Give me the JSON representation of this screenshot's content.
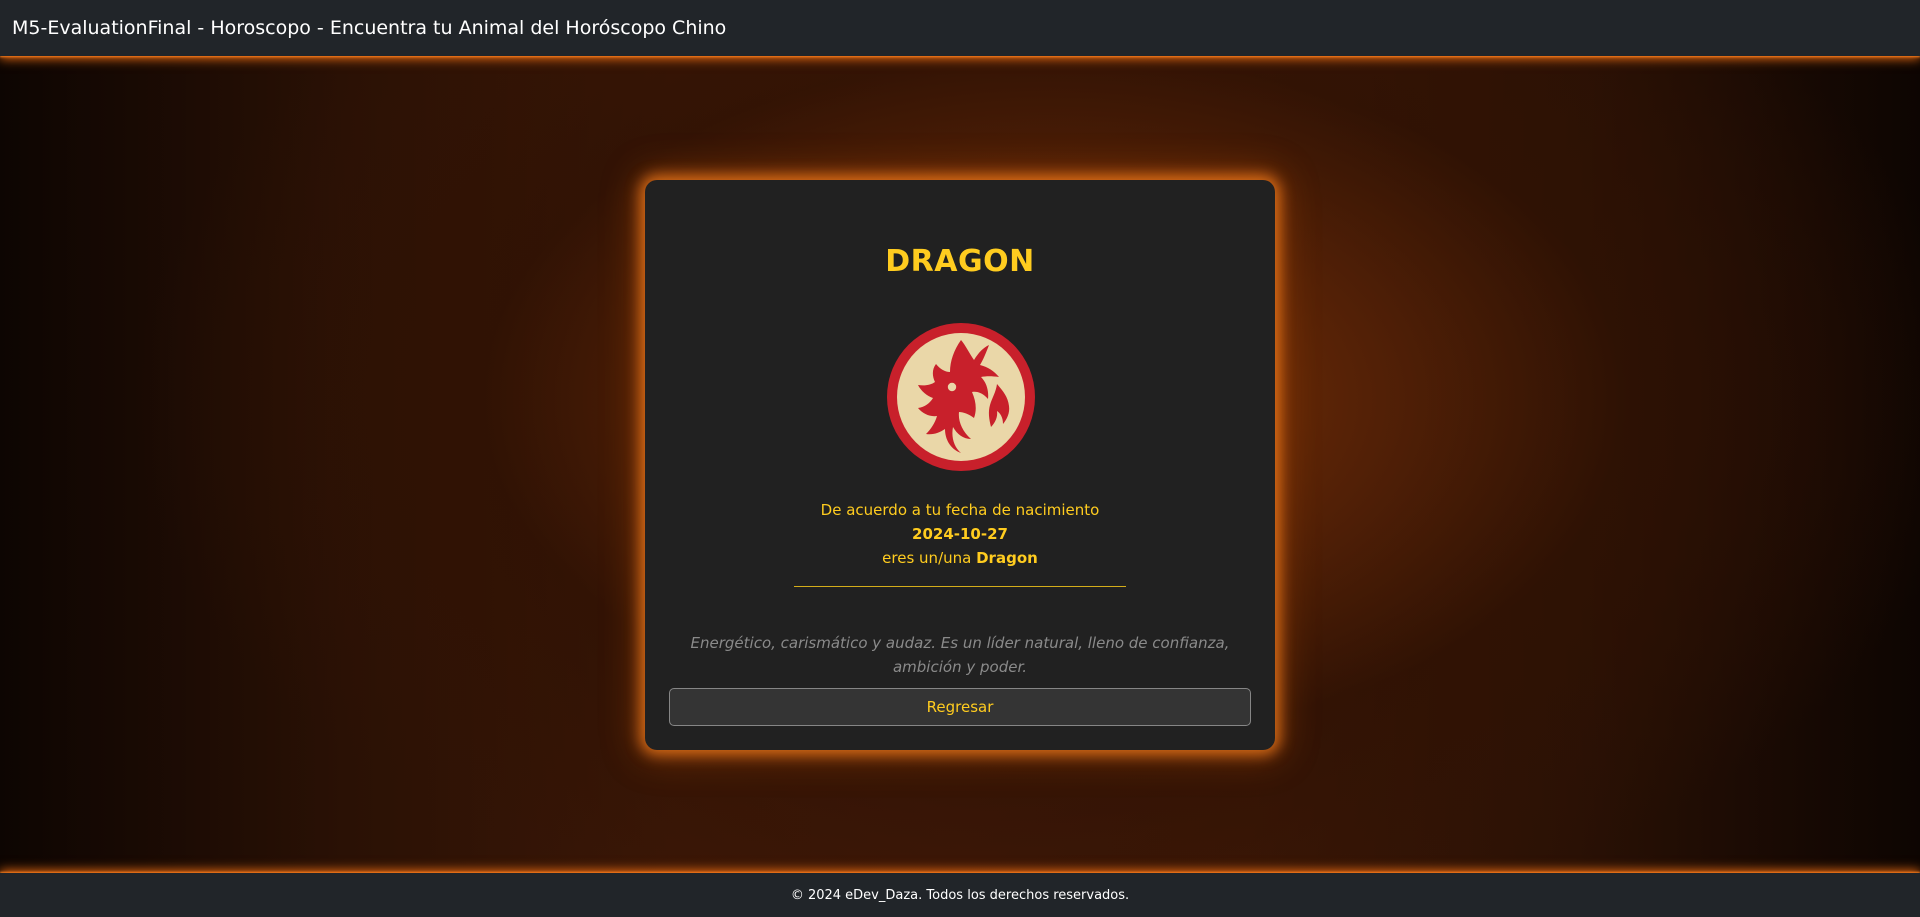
{
  "header": {
    "title": "M5-EvaluationFinal - Horoscopo - Encuentra tu Animal del Horóscopo Chino"
  },
  "result": {
    "animal_title": "DRAGON",
    "image_icon": "dragon-emblem-icon",
    "intro": "De acuerdo a tu fecha de nacimiento",
    "birth_date": "2024-10-27",
    "result_prefix": "eres un/una",
    "animal_name": "Dragon",
    "description": "Energético, carismático y audaz. Es un líder natural, lleno de confianza, ambición y poder.",
    "back_button": "Regresar"
  },
  "footer": {
    "copyright": "© 2024 eDev_Daza. Todos los derechos reservados."
  },
  "colors": {
    "accent_gold": "#ffcc1f",
    "glow_orange": "#ff8a1e",
    "card_bg": "#212121",
    "bar_bg": "#212529",
    "emblem_red": "#c8202b",
    "emblem_cream": "#ead7a8"
  }
}
